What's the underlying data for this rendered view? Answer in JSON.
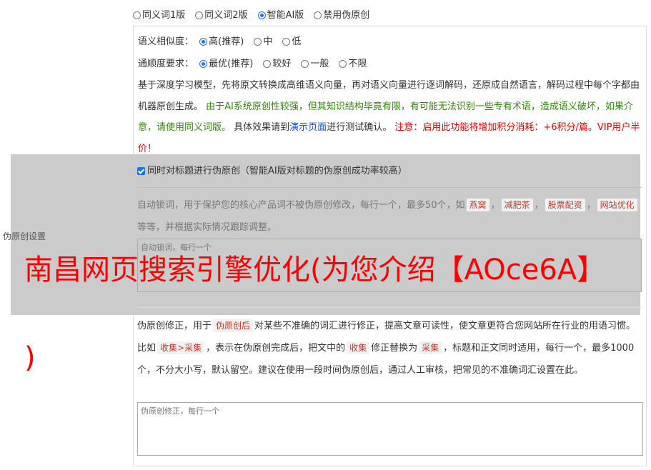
{
  "mode": {
    "options": [
      "同义词1版",
      "同义词2版",
      "智能AI版",
      "禁用伪原创"
    ],
    "selected": 2
  },
  "similarity": {
    "label": "语义相似度：",
    "options": [
      "高(推荐)",
      "中",
      "低"
    ],
    "selected": 0
  },
  "fluency": {
    "label": "通顺度要求：",
    "options": [
      "最优(推荐)",
      "较好",
      "一般",
      "不限"
    ],
    "selected": 0
  },
  "description": {
    "part1": "基于深度学习模型，先将原文转换成高维语义向量，再对语义向量进行逐词解码，还原成自然语言，解码过程中每个字都由机器原创生成。",
    "part2_green": "由于AI系统原创性较强，但其知识结构毕竟有限，有可能无法识别一些专有术语，造成语义破坏，如果介意，请使用同义词版。",
    "part3": "具体效果请到",
    "demo_link": "演示页面",
    "part4": "进行测试确认。",
    "part5_red": "注意：启用此功能将增加积分消耗：+6积分/篇。VIP用户半价！"
  },
  "title_option": {
    "label": "同时对标题进行伪原创（智能AI版对标题的伪原创成功率较高）",
    "checked": true
  },
  "lock_words": {
    "desc_pre": "自动锁词，用于保护您的核心产品词不被伪原创修改，每行一个，最多50个，如",
    "examples": [
      "燕窝",
      "减肥茶",
      "股票配资",
      "网站优化"
    ],
    "desc_post": "等等，并根据实际情况跟踪调整。",
    "placeholder": "自动锁词，每行一个"
  },
  "side_label": "伪原创设置",
  "headline": "南昌网页搜索引擎优化(为您介绍【AOce6A】",
  "headline_tail": ")",
  "fix_words": {
    "desc_1": "伪原创修正，用于",
    "tag_after": "伪原创后",
    "desc_2": "对某些不准确的词汇进行修正，提高文章可读性，使文章更符合您网站所在行业的用语习惯。比如",
    "tag_example": "收集>采集",
    "desc_3": "，表示在伪原创完成后，把文中的",
    "tag_from": "收集",
    "desc_4": "修正替换为",
    "tag_to": "采集",
    "desc_5": "，标题和正文同时适用，每行一个，最多1000个，不分大小写，默认留空。建议在使用一段时间伪原创后，通过人工审核，把常见的不准确词汇设置在此。",
    "placeholder": "伪原创修正，每行一个"
  }
}
